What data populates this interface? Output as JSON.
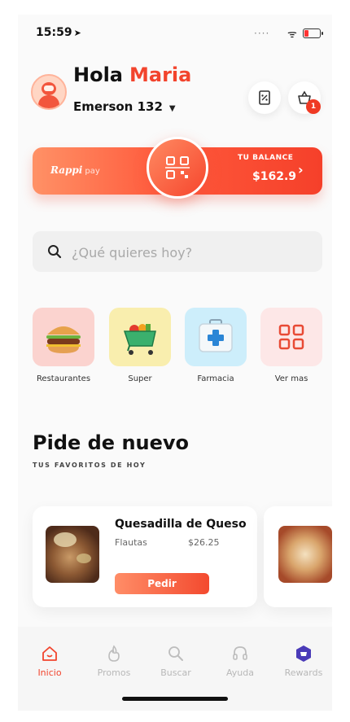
{
  "status_bar": {
    "time": "15:59",
    "location_glyph": "➤",
    "signal_glyph": "····",
    "wifi_glyph": "ᯤ"
  },
  "header": {
    "greeting": "Hola",
    "user_name": "Maria",
    "address": "Emerson 132",
    "cart_count": "1"
  },
  "pay_card": {
    "brand": "Rappi",
    "brand_sub": "pay",
    "balance_label": "TU BALANCE",
    "balance_value": "$162.9",
    "chevron": "›"
  },
  "search": {
    "placeholder": "¿Qué quieres hoy?"
  },
  "categories": [
    {
      "label": "Restaurantes",
      "icon": "burger-icon"
    },
    {
      "label": "Super",
      "icon": "shopping-cart-icon"
    },
    {
      "label": "Farmacia",
      "icon": "first-aid-kit-icon"
    },
    {
      "label": "Ver mas",
      "icon": "grid-icon"
    }
  ],
  "reorder": {
    "title": "Pide de nuevo",
    "subtitle": "TUS FAVORITOS DE HOY",
    "items": [
      {
        "name": "Quesadilla de Queso",
        "description": "Flautas",
        "price": "$26.25",
        "button": "Pedir"
      }
    ]
  },
  "bottom_nav": {
    "items": [
      {
        "label": "Inicio",
        "active": true
      },
      {
        "label": "Promos",
        "active": false
      },
      {
        "label": "Buscar",
        "active": false
      },
      {
        "label": "Ayuda",
        "active": false
      },
      {
        "label": "Rewards",
        "active": false
      }
    ]
  },
  "colors": {
    "accent": "#f2442d",
    "accent_light": "#ff8d67",
    "rewards": "#4a3bb8"
  }
}
